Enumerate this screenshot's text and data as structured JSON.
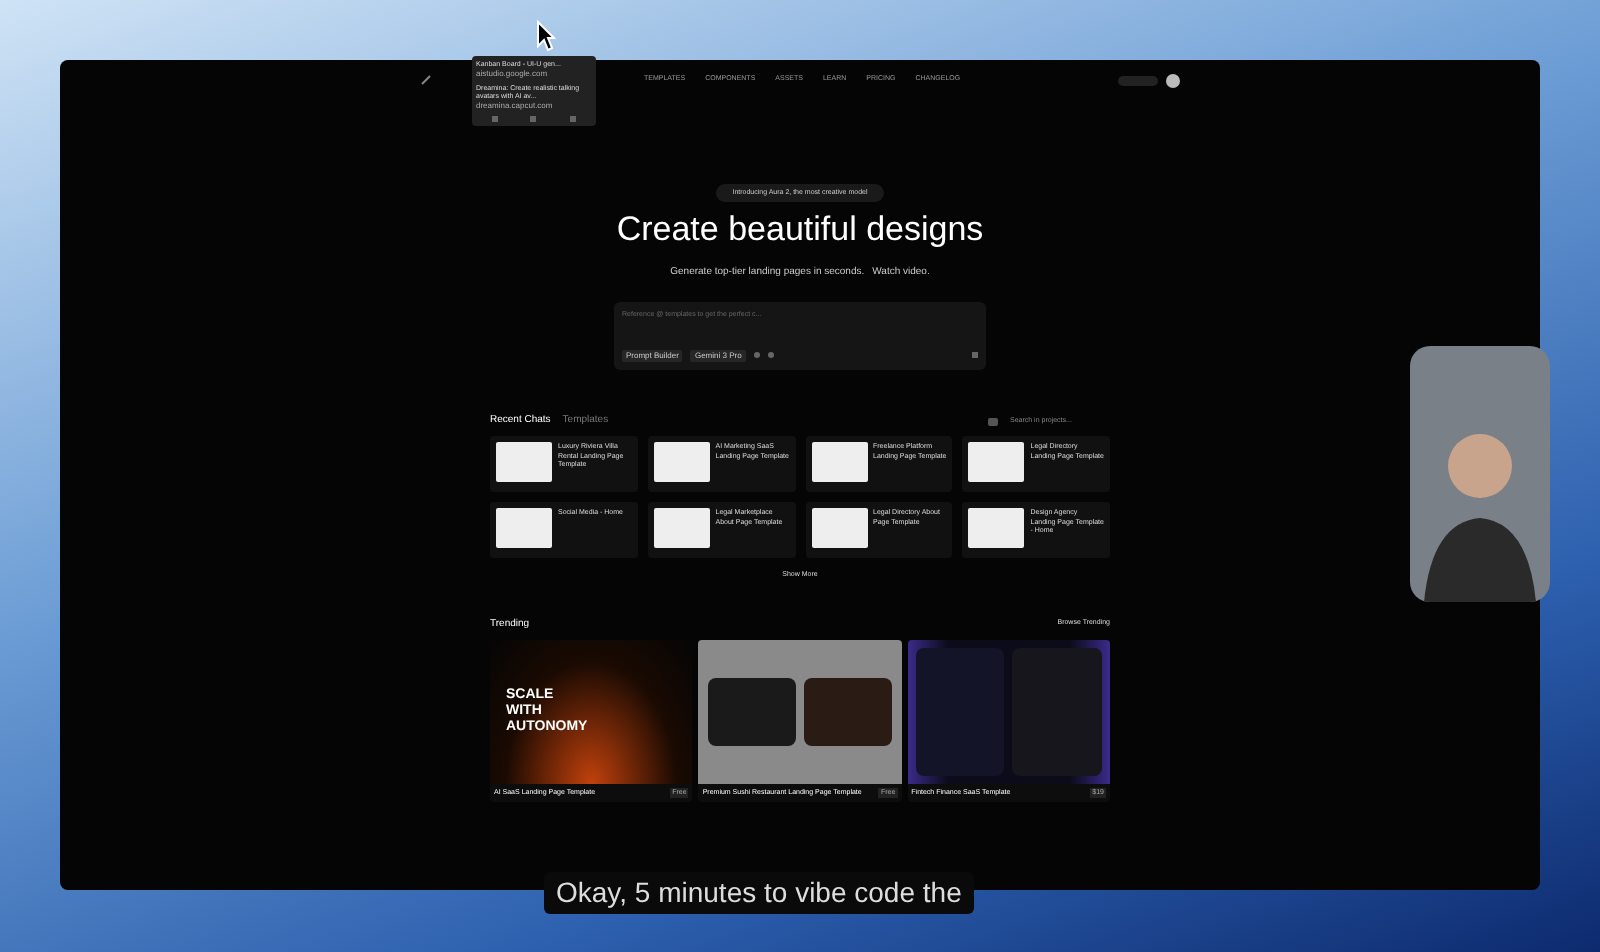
{
  "nav": {
    "items": [
      "TEMPLATES",
      "COMPONENTS",
      "ASSETS",
      "LEARN",
      "PRICING",
      "CHANGELOG"
    ]
  },
  "tab_preview": {
    "items": [
      {
        "title": "Kanban Board - UI-U gen...",
        "url": "aistudio.google.com"
      },
      {
        "title": "Dreamina: Create realistic talking avatars with AI av...",
        "url": "dreamina.capcut.com"
      }
    ]
  },
  "hero": {
    "badge": "Introducing Aura 2, the most creative model",
    "title": "Create beautiful designs",
    "subtitle": "Generate top-tier landing pages in seconds.",
    "link": "Watch video.",
    "prompt": {
      "placeholder": "Reference @ templates to get the perfect c...",
      "buttons": [
        "Prompt Builder",
        "Gemini 3 Pro"
      ]
    }
  },
  "recent": {
    "tabs": [
      {
        "label": "Recent Chats",
        "selected": true
      },
      {
        "label": "Templates",
        "selected": false
      }
    ],
    "search": {
      "placeholder": "Search in projects..."
    },
    "cards": [
      {
        "title": "Luxury Riviera Villa Rental Landing Page Template"
      },
      {
        "title": "AI Marketing SaaS Landing Page Template"
      },
      {
        "title": "Freelance Platform Landing Page Template"
      },
      {
        "title": "Legal Directory Landing Page Template"
      },
      {
        "title": "Social Media - Home"
      },
      {
        "title": "Legal Marketplace About Page Template"
      },
      {
        "title": "Legal Directory About Page Template"
      },
      {
        "title": "Design Agency Landing Page Template - Home"
      }
    ],
    "show_more": "Show More"
  },
  "trending": {
    "title": "Trending",
    "browse": "Browse Trending",
    "cards": [
      {
        "title": "AI SaaS Landing Page Template",
        "price": "Free",
        "preview_text": "SCALE WITH AUTONOMY",
        "kind": "orange"
      },
      {
        "title": "Premium Sushi Restaurant Landing Page Template",
        "price": "Free",
        "kind": "gray"
      },
      {
        "title": "Fintech Finance SaaS Template",
        "price": "$19",
        "kind": "purple"
      }
    ]
  },
  "caption": "Okay, 5 minutes to vibe code the"
}
